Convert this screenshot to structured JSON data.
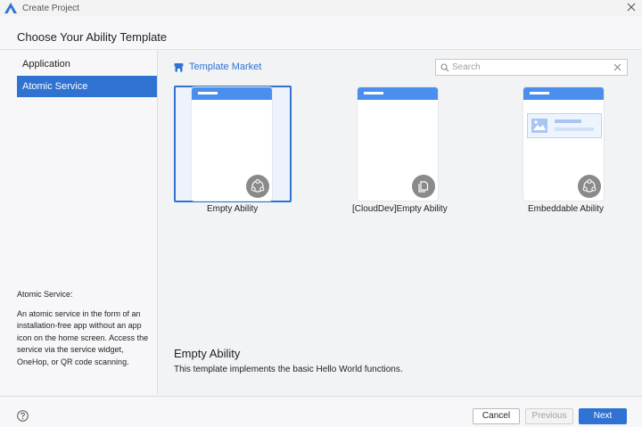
{
  "window": {
    "title": "Create Project",
    "close_icon": "close-icon",
    "logo_icon": "deveco-logo-icon"
  },
  "header": {
    "title": "Choose Your Ability Template"
  },
  "sidebar": {
    "items": [
      {
        "label": "Application",
        "active": false
      },
      {
        "label": "Atomic Service",
        "active": true
      }
    ],
    "description": {
      "title": "Atomic Service:",
      "text": "An atomic service in the form of an installation-free app without an app icon on the home screen. Access the service via the service widget, OneHop, or QR code scanning."
    }
  },
  "main": {
    "market_label": "Template Market",
    "search": {
      "placeholder": "Search",
      "value": ""
    },
    "templates": [
      {
        "label": "Empty Ability",
        "selected": true,
        "badge_icon": "atomic-service-icon"
      },
      {
        "label": "[CloudDev]Empty Ability",
        "selected": false,
        "badge_icon": "cloud-copy-icon"
      },
      {
        "label": "Embeddable Ability",
        "selected": false,
        "badge_icon": "atomic-service-icon"
      }
    ],
    "detail": {
      "title": "Empty Ability",
      "description": "This template implements the basic Hello World functions."
    }
  },
  "footer": {
    "cancel_label": "Cancel",
    "previous_label": "Previous",
    "next_label": "Next"
  },
  "colors": {
    "accent": "#2f72d2",
    "phone_bar": "#4b8fee"
  }
}
